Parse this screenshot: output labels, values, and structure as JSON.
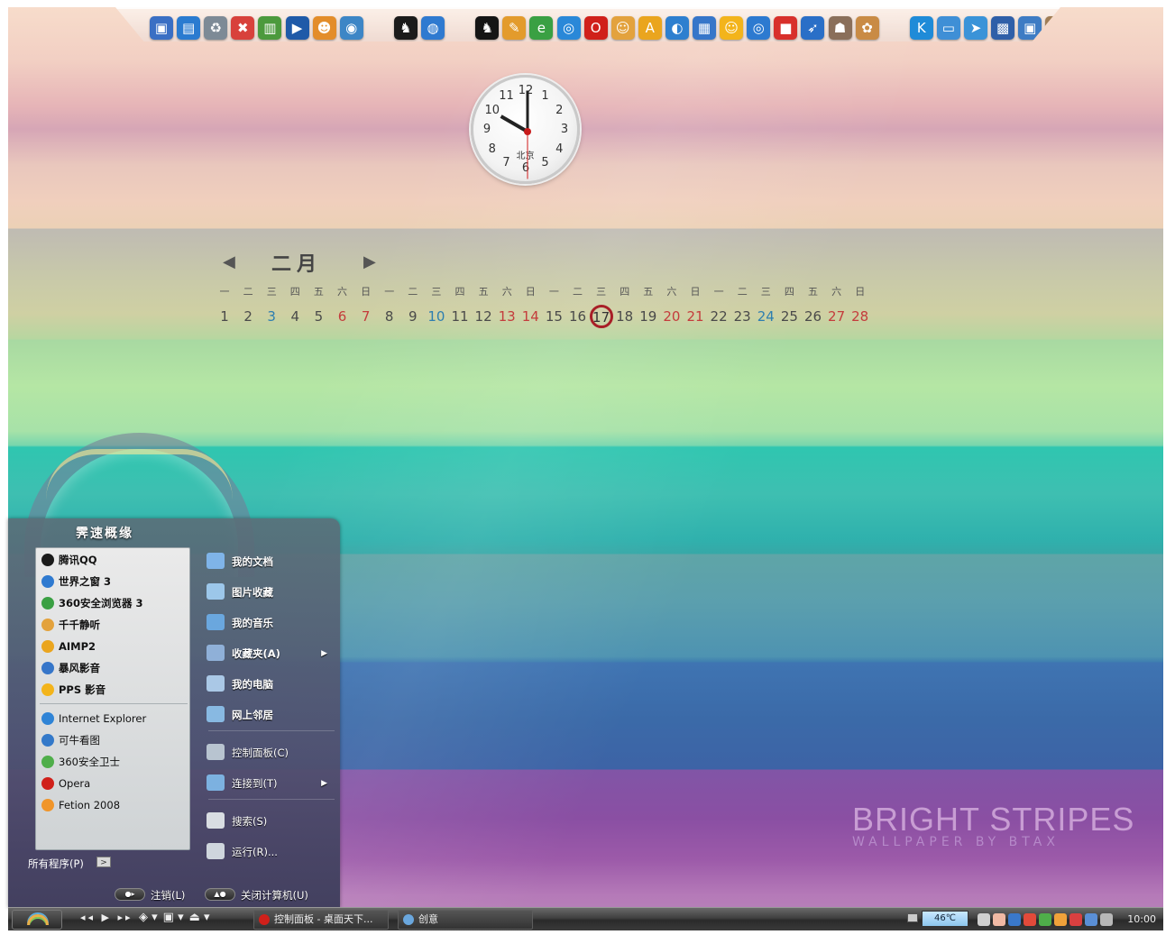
{
  "dock": {
    "icons": [
      {
        "name": "computer-icon",
        "color": "#3a6fc4",
        "glyph": "▣"
      },
      {
        "name": "network-icon",
        "color": "#2a7bd0",
        "glyph": "▤"
      },
      {
        "name": "recycle-bin-icon",
        "color": "#7d8a96",
        "glyph": "♻"
      },
      {
        "name": "tools-icon",
        "color": "#d8413b",
        "glyph": "✖"
      },
      {
        "name": "folder-icon",
        "color": "#4c9a3d",
        "glyph": "▥"
      },
      {
        "name": "media-player-icon",
        "color": "#1f5aa8",
        "glyph": "▶"
      },
      {
        "name": "mascot-icon",
        "color": "#e38d2a",
        "glyph": "☻"
      },
      {
        "name": "globe-icon",
        "color": "#3d86c6",
        "glyph": "◉"
      },
      {
        "name": "qq-icon",
        "color": "#1b1b1b",
        "glyph": "♞"
      },
      {
        "name": "world-browser-icon",
        "color": "#2f7ad0",
        "glyph": "◍"
      },
      {
        "name": "qq-penguin-icon",
        "color": "#151515",
        "glyph": "♞"
      },
      {
        "name": "feather-icon",
        "color": "#e39b2c",
        "glyph": "✎"
      },
      {
        "name": "browser-360-icon",
        "color": "#3aa043",
        "glyph": "e"
      },
      {
        "name": "world-window-icon",
        "color": "#2a88d8",
        "glyph": "◎"
      },
      {
        "name": "opera-icon",
        "color": "#d0201a",
        "glyph": "O"
      },
      {
        "name": "ttplayer-icon",
        "color": "#e3a23d",
        "glyph": "☺"
      },
      {
        "name": "aimp-icon",
        "color": "#eaa51e",
        "glyph": "A"
      },
      {
        "name": "search-globe-icon",
        "color": "#2e7fcf",
        "glyph": "◐"
      },
      {
        "name": "storm-player-icon",
        "color": "#3676c9",
        "glyph": "▦"
      },
      {
        "name": "pps-icon",
        "color": "#f3b41b",
        "glyph": "☺"
      },
      {
        "name": "disc-icon",
        "color": "#2d7ad0",
        "glyph": "◎"
      },
      {
        "name": "red-app-icon",
        "color": "#d8302b",
        "glyph": "■"
      },
      {
        "name": "swift-icon",
        "color": "#2a6fc7",
        "glyph": "➶"
      },
      {
        "name": "users-icon",
        "color": "#8a6f5a",
        "glyph": "☗"
      },
      {
        "name": "paint-icon",
        "color": "#c98b45",
        "glyph": "✿"
      },
      {
        "name": "kugou-icon",
        "color": "#1f8bd8",
        "glyph": "K"
      },
      {
        "name": "monitor-icon",
        "color": "#3f8fd6",
        "glyph": "▭"
      },
      {
        "name": "arrow-app-icon",
        "color": "#3a93d8",
        "glyph": "➤"
      },
      {
        "name": "movie-icon",
        "color": "#2f5fa8",
        "glyph": "▩"
      },
      {
        "name": "tv-icon",
        "color": "#3e7cc4",
        "glyph": "▣"
      },
      {
        "name": "camera-icon",
        "color": "#a07d55",
        "glyph": "◙"
      }
    ]
  },
  "clock": {
    "numbers": [
      "12",
      "1",
      "2",
      "3",
      "4",
      "5",
      "6",
      "7",
      "8",
      "9",
      "10",
      "11"
    ],
    "city": "北京"
  },
  "calendar": {
    "month": "二月",
    "prev_icon": "chevron-left-icon",
    "next_icon": "chevron-right-icon",
    "weekdays": [
      "一",
      "二",
      "三",
      "四",
      "五",
      "六",
      "日",
      "一",
      "二",
      "三",
      "四",
      "五",
      "六",
      "日",
      "一",
      "二",
      "三",
      "四",
      "五",
      "六",
      "日",
      "一",
      "二",
      "三",
      "四",
      "五",
      "六",
      "日"
    ],
    "days": [
      "1",
      "2",
      "3",
      "4",
      "5",
      "6",
      "7",
      "8",
      "9",
      "10",
      "11",
      "12",
      "13",
      "14",
      "15",
      "16",
      "17",
      "18",
      "19",
      "20",
      "21",
      "22",
      "23",
      "24",
      "25",
      "26",
      "27",
      "28"
    ],
    "today": "17",
    "colors": {
      "weekday": "#4a4a4a",
      "saturday": "#2d7eb0",
      "sunday": "#c43c3c",
      "today_ring": "#a81f27"
    }
  },
  "watermark": {
    "title": "BRIGHT STRIPES",
    "subtitle": "WALLPAPER BY BTAX"
  },
  "start_menu": {
    "user_name": "霁速概缘",
    "pinned": [
      {
        "label": "腾讯QQ",
        "icon": "qq-icon",
        "color": "#1b1b1b"
      },
      {
        "label": "世界之窗 3",
        "icon": "world-browser-icon",
        "color": "#2f7ad0"
      },
      {
        "label": "360安全浏览器 3",
        "icon": "browser-360-icon",
        "color": "#3aa043"
      },
      {
        "label": "千千静听",
        "icon": "ttplayer-icon",
        "color": "#e3a23d"
      },
      {
        "label": "AIMP2",
        "icon": "aimp-icon",
        "color": "#eaa51e"
      },
      {
        "label": "暴风影音",
        "icon": "storm-player-icon",
        "color": "#3676c9"
      },
      {
        "label": "PPS 影音",
        "icon": "pps-icon",
        "color": "#f3b41b"
      }
    ],
    "recent": [
      {
        "label": "Internet Explorer",
        "icon": "internet-explorer-icon",
        "color": "#2f84d6"
      },
      {
        "label": "可牛看图",
        "icon": "eye-icon",
        "color": "#3379c9"
      },
      {
        "label": "360安全卫士",
        "icon": "shield-icon",
        "color": "#4fae4a"
      },
      {
        "label": "Opera",
        "icon": "opera-icon",
        "color": "#d0201a"
      },
      {
        "label": "Fetion 2008",
        "icon": "fetion-icon",
        "color": "#f0952a"
      }
    ],
    "all_programs": "所有程序(P)",
    "all_programs_arrow": ">",
    "places": [
      {
        "label": "我的文档",
        "icon": "documents-icon",
        "color": "#7fb4e8",
        "bold": true,
        "submenu": ""
      },
      {
        "label": "图片收藏",
        "icon": "pictures-icon",
        "color": "#9cc7ea",
        "bold": true,
        "submenu": ""
      },
      {
        "label": "我的音乐",
        "icon": "music-icon",
        "color": "#6aa7de",
        "bold": true,
        "submenu": ""
      },
      {
        "label": "收藏夹(A)",
        "icon": "favorites-icon",
        "color": "#8fb0d8",
        "bold": true,
        "submenu": "▶"
      },
      {
        "label": "我的电脑",
        "icon": "computer-icon",
        "color": "#aac8e6",
        "bold": true,
        "submenu": ""
      },
      {
        "label": "网上邻居",
        "icon": "network-icon",
        "color": "#88b9e2",
        "bold": true,
        "submenu": ""
      },
      {
        "label": "控制面板(C)",
        "icon": "control-panel-icon",
        "color": "#b8c4d0",
        "bold": false,
        "submenu": ""
      },
      {
        "label": "连接到(T)",
        "icon": "connect-icon",
        "color": "#7cb1e0",
        "bold": false,
        "submenu": "▶"
      },
      {
        "label": "搜索(S)",
        "icon": "search-icon",
        "color": "#d9dde2",
        "bold": false,
        "submenu": ""
      },
      {
        "label": "运行(R)...",
        "icon": "run-icon",
        "color": "#cfd6dd",
        "bold": false,
        "submenu": ""
      }
    ],
    "logoff": "注销(L)",
    "shutdown": "关闭计算机(U)"
  },
  "taskbar": {
    "media_controls": "◂◂ ▶ ▸▸",
    "quick_launch": [
      "◈ ▾",
      "▣ ▾",
      "⏏ ▾"
    ],
    "tasks": [
      {
        "label": "控制面板 - 桌面天下...",
        "icon": "opera-icon",
        "color": "#d0201a"
      },
      {
        "label": "创意",
        "icon": "folder-icon",
        "color": "#6aa7de"
      }
    ],
    "temperature": "46℃",
    "tray_icons": [
      {
        "name": "tray-menu-icon",
        "color": "#cfcfcf"
      },
      {
        "name": "tray-face-icon",
        "color": "#f0b9a4"
      },
      {
        "name": "tray-monitor-icon",
        "color": "#3a78c9"
      },
      {
        "name": "tray-user-icon",
        "color": "#e24a3a"
      },
      {
        "name": "tray-shield-icon",
        "color": "#4fae4a"
      },
      {
        "name": "tray-chat-icon",
        "color": "#f0a23a"
      },
      {
        "name": "tray-network-icon",
        "color": "#d94040"
      },
      {
        "name": "tray-display-icon",
        "color": "#5a8fd6"
      },
      {
        "name": "tray-tool-icon",
        "color": "#b8b8b8"
      }
    ],
    "time": "10:00"
  }
}
